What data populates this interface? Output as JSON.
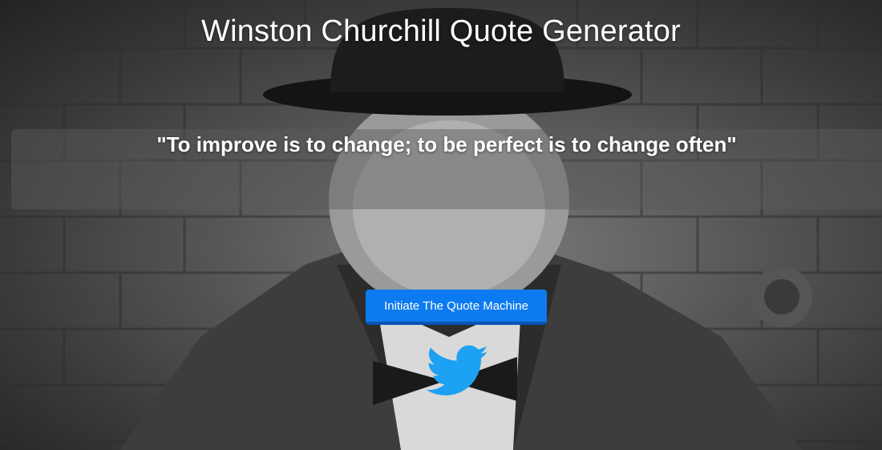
{
  "page": {
    "title": "Winston Churchill Quote Generator"
  },
  "quote": {
    "text": "\"To improve is to change; to be perfect is to change often\""
  },
  "actions": {
    "generate_label": "Initiate The Quote Machine",
    "tweet_icon": "twitter-bird-icon"
  },
  "colors": {
    "button": "#0d7bf0",
    "button_border": "#0a52b8",
    "twitter_blue": "#1da1f2",
    "text": "#ffffff"
  }
}
